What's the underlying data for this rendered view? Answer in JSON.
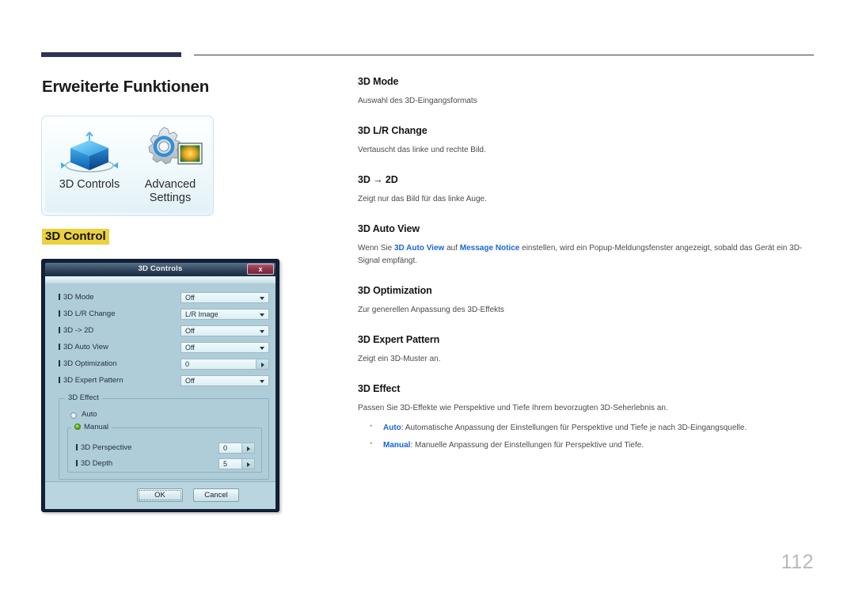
{
  "page": {
    "title": "Erweiterte Funktionen",
    "number": "112"
  },
  "icon_panel": {
    "items": [
      {
        "label": "3D Controls",
        "icon": "3d-cube-icon"
      },
      {
        "label_line1": "Advanced",
        "label_line2": "Settings",
        "icon": "gear-picture-icon"
      }
    ]
  },
  "section": {
    "heading": "3D Control"
  },
  "dialog": {
    "title": "3D Controls",
    "close_label": "x",
    "rows": [
      {
        "label": "3D Mode",
        "value": "Off",
        "control": "dropdown"
      },
      {
        "label": "3D L/R Change",
        "value": "L/R Image",
        "control": "dropdown"
      },
      {
        "label": "3D -> 2D",
        "value": "Off",
        "control": "dropdown"
      },
      {
        "label": "3D Auto View",
        "value": "Off",
        "control": "dropdown"
      },
      {
        "label": "3D Optimization",
        "value": "0",
        "control": "spinner"
      },
      {
        "label": "3D Expert Pattern",
        "value": "Off",
        "control": "dropdown"
      }
    ],
    "effect_group": {
      "legend": "3D Effect",
      "auto_label": "Auto",
      "auto_selected": false,
      "manual_label": "Manual",
      "manual_selected": true,
      "manual_rows": [
        {
          "label": "3D Perspective",
          "value": "0",
          "control": "spinner"
        },
        {
          "label": "3D Depth",
          "value": "5",
          "control": "spinner"
        }
      ]
    },
    "buttons": {
      "ok": "OK",
      "cancel": "Cancel"
    }
  },
  "content": {
    "items": [
      {
        "heading": "3D Mode",
        "body_html": "Auswahl des 3D-Eingangsformats"
      },
      {
        "heading": "3D L/R Change",
        "body_html": "Vertauscht das linke und rechte Bild."
      },
      {
        "heading": "3D → 2D",
        "body_html": "Zeigt nur das Bild für das linke Auge."
      },
      {
        "heading": "3D Auto View",
        "body_html": "Wenn Sie <span class=\"accent\">3D Auto View</span> auf <span class=\"accent\">Message Notice</span> einstellen, wird ein Popup-Meldungsfenster angezeigt, sobald das Gerät ein 3D-Signal empfängt."
      },
      {
        "heading": "3D Optimization",
        "body_html": "Zur generellen Anpassung des 3D-Effekts"
      },
      {
        "heading": "3D Expert Pattern",
        "body_html": "Zeigt ein 3D-Muster an."
      },
      {
        "heading": "3D Effect",
        "body_html": "Passen Sie 3D-Effekte wie Perspektive und Tiefe Ihrem bevorzugten 3D-Seherlebnis an.",
        "bullets_html": [
          "<span class=\"accent\">Auto</span>: Automatische Anpassung der Einstellungen für Perspektive und Tiefe je nach 3D-Eingangsquelle.",
          "<span class=\"accent\">Manual</span>: Manuelle Anpassung der Einstellungen für Perspektive und Tiefe."
        ]
      }
    ]
  },
  "colors": {
    "rule": "#2f3355",
    "highlight": "#ecd13f",
    "accent": "#1a66d6",
    "page_number": "#b9b9b9"
  }
}
